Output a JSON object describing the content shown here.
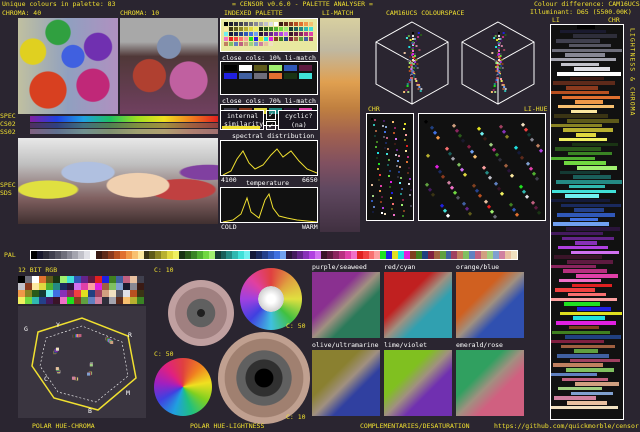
{
  "header": {
    "left": "Unique colours in palette: 83",
    "center": "= CENSOR v0.6.0 - PALETTE ANALYSER =",
    "right1": "Colour difference: CAM16UCS",
    "right2": "Illuminant: D65 (5500.00K)"
  },
  "top_labels": {
    "chroma40": "CHROMA: 40",
    "chroma10": "CHROMA: 10",
    "indexed": "INDEXED PALETTE",
    "limatch": "LI-MATCH",
    "cam16": "CAM16UCS COLOURSPACE",
    "li": "LI",
    "chr": "CHR",
    "side_vertical": "LIGHTNESS & CHROMA"
  },
  "side_labels": {
    "spec": "SPEC",
    "cs02": "CS02",
    "ss02": "SS02",
    "spec2": "SPEC",
    "sds": "SDS"
  },
  "mid": {
    "close30": "close cols: 10% li-match",
    "close70": "close cols: 70% li-match",
    "internal": "internal",
    "similarity": "similarity",
    "cyclic": "cyclic?",
    "na": "(na)",
    "spectral": "spectral distribution",
    "s_lo": "4100",
    "s_hi": "6650",
    "temperature": "temperature",
    "cold": "COLD",
    "warm": "WARM"
  },
  "scatter": {
    "chr": "CHR",
    "lihue": "LI-HUE"
  },
  "pal_label": "PAL",
  "bottom": {
    "bit": "12 BIT RGB",
    "c10a": "C: 10",
    "c50a": "C: 50",
    "c50b": "C: 50",
    "c10b": "C: 10",
    "polar_hc": "POLAR HUE-CHROMA",
    "polar_hl": "POLAR HUE-LIGHTNESS",
    "compl": "COMPLEMENTARIES/DESATURATION",
    "url": "https://github.com/quickmorble/censor"
  },
  "hue_letters": [
    "Y",
    "R",
    "M",
    "B",
    "C",
    "G"
  ],
  "pairs": [
    {
      "label": "purple/seaweed"
    },
    {
      "label": "red/cyan"
    },
    {
      "label": "orange/blue"
    },
    {
      "label": "olive/ultramarine"
    },
    {
      "label": "lime/violet"
    },
    {
      "label": "emerald/rose"
    }
  ],
  "colors": {
    "accent": "#f0e030",
    "bg": "#2a2530",
    "panel_border": "#ffffff"
  },
  "palette": [
    "#000000",
    "#1a1a2e",
    "#2e2e3a",
    "#40404e",
    "#565662",
    "#6e6e7a",
    "#888894",
    "#a4a4ae",
    "#c2c2ca",
    "#e0e0e6",
    "#ffffff",
    "#3a1a14",
    "#5e2a1a",
    "#8a3a1e",
    "#b85020",
    "#e07030",
    "#f09848",
    "#f8c070",
    "#fce8a0",
    "#3a3414",
    "#5e5a1a",
    "#8a8424",
    "#b8b030",
    "#e0d840",
    "#f0f060",
    "#1a3414",
    "#2a5a1a",
    "#3a8424",
    "#50b030",
    "#70d840",
    "#a0f070",
    "#143a34",
    "#1a5e5a",
    "#248a84",
    "#30b8b0",
    "#40e0d8",
    "#70f0f0",
    "#141a3a",
    "#1a2a5e",
    "#24408a",
    "#3058b8",
    "#4070e0",
    "#70a0f0",
    "#2a143a",
    "#441a5e",
    "#64248a",
    "#8830b8",
    "#b040e0",
    "#d070f0",
    "#3a1428",
    "#5e1a40",
    "#8a245e",
    "#b83080",
    "#e040a8",
    "#f070c8",
    "#e02020",
    "#f04040",
    "#f87070",
    "#fca0a0",
    "#20e020",
    "#2020e0",
    "#e0e020",
    "#20e0e0",
    "#e020e0",
    "#804020",
    "#408020",
    "#204080",
    "#802040",
    "#a06040",
    "#60a040",
    "#4060a0",
    "#a04060",
    "#c08060",
    "#80c060",
    "#6080c0",
    "#c06080",
    "#d0a080",
    "#a0d080",
    "#80a0d0",
    "#d080a0",
    "#e8c0a0",
    "#f0e0c0"
  ]
}
